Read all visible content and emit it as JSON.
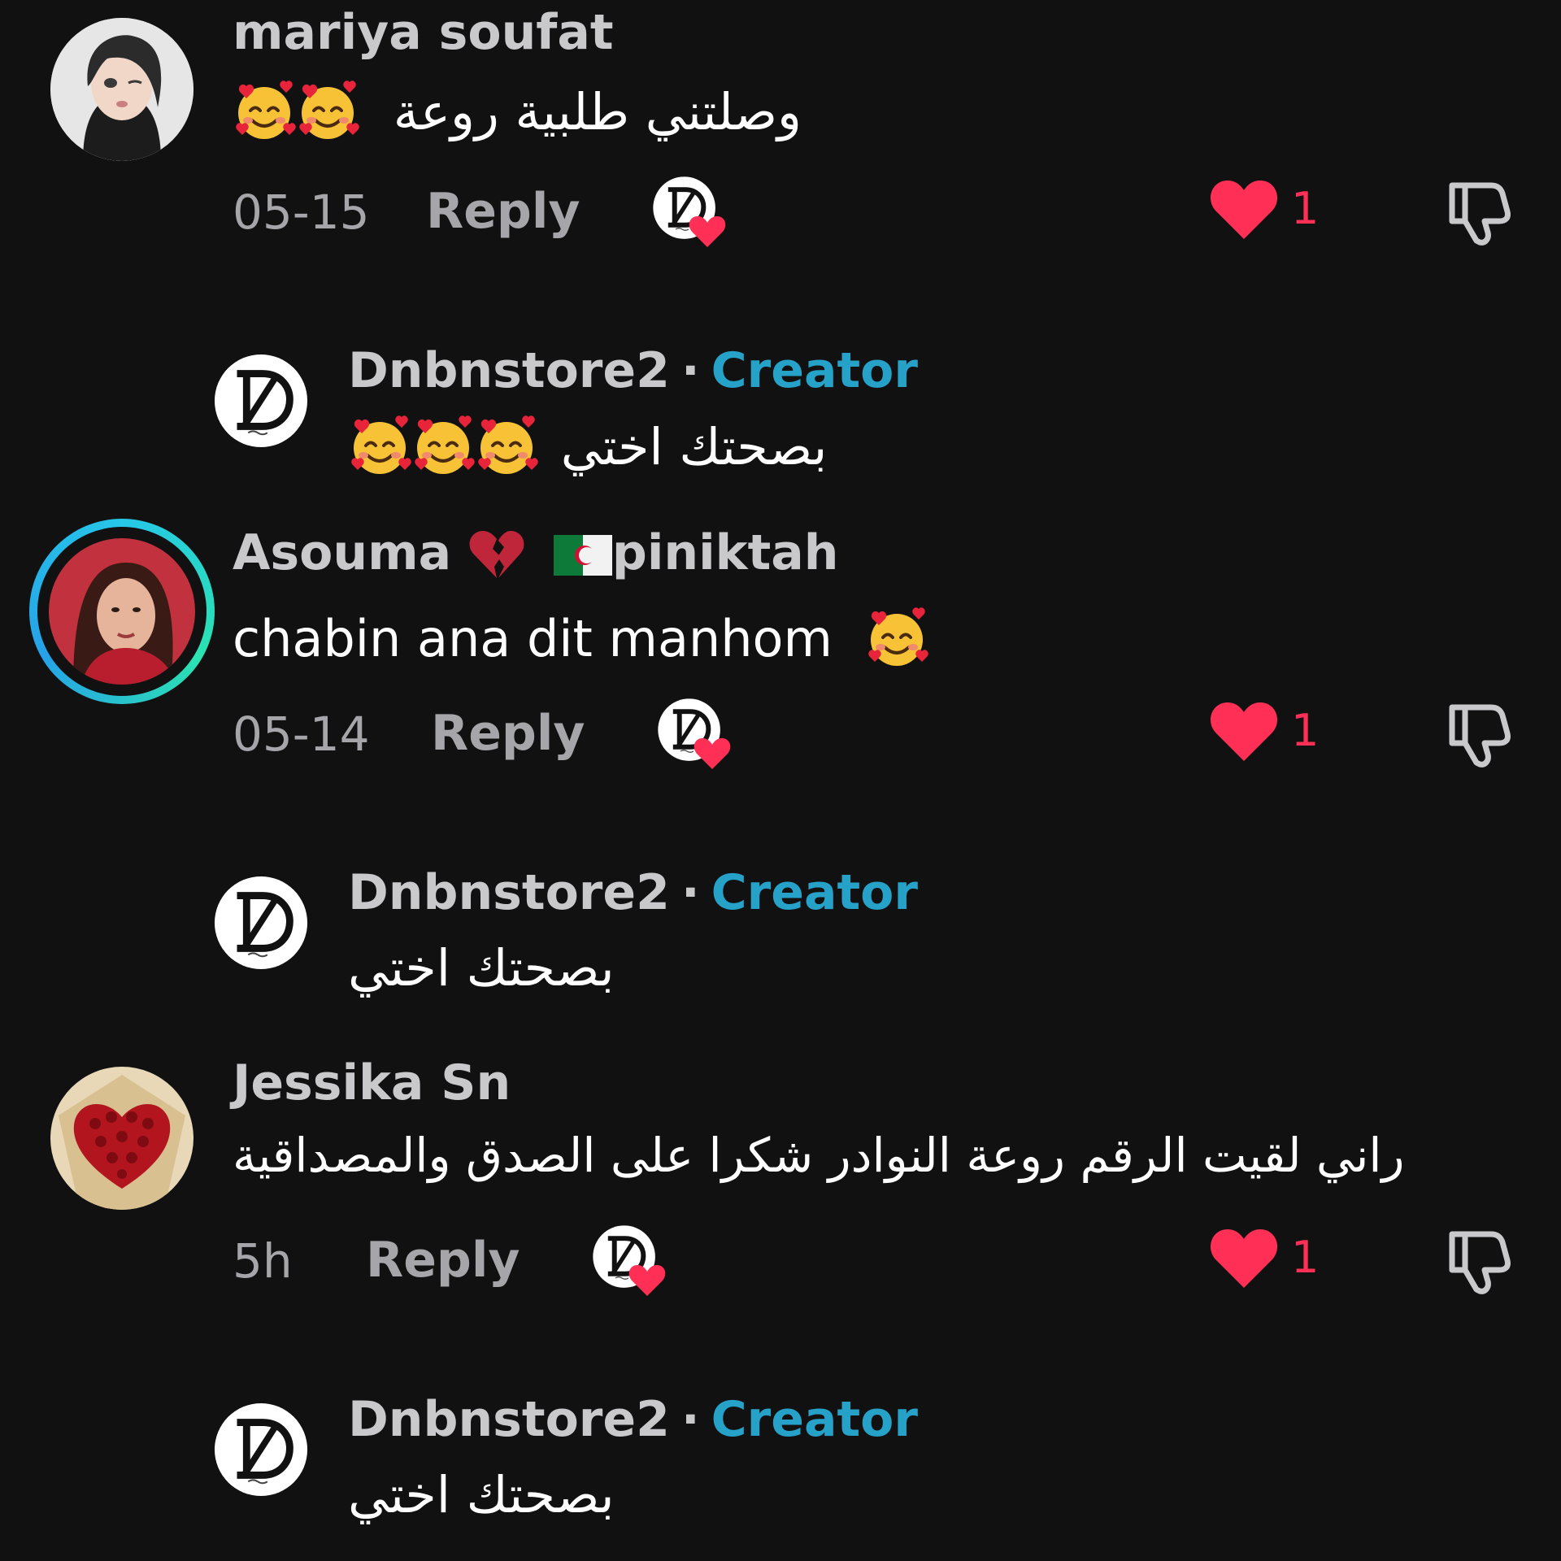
{
  "colors": {
    "background": "#111112",
    "username": "#c9c9cc",
    "creator_badge": "#26a2c9",
    "like_heart": "#ff2f56",
    "meta_text": "#a6a6aa"
  },
  "icons": {
    "emoji": "smiling-face-with-hearts",
    "like": "heart-icon",
    "dislike": "thumbs-down-icon",
    "creator_liked": "creator-avatar-with-heart"
  },
  "comments": [
    {
      "username": "mariya soufat",
      "text": "وصلتني طلبية روعة",
      "date": "05-15",
      "reply_label": "Reply",
      "like_count": "1"
    },
    {
      "username": "Dnbnstore2",
      "creator_label": "Creator",
      "text": "بصحتك اختي",
      "is_reply": true
    },
    {
      "username": "Asouma",
      "username_suffix": "piniktah",
      "text": "chabin ana dit manhom",
      "date": "05-14",
      "reply_label": "Reply",
      "like_count": "1"
    },
    {
      "username": "Dnbnstore2",
      "creator_label": "Creator",
      "text": "بصحتك اختي",
      "is_reply": true
    },
    {
      "username": "Jessika Sn",
      "text": "راني لقيت الرقم روعة النوادر شكرا على الصدق والمصداقية",
      "date": "5h",
      "reply_label": "Reply",
      "like_count": "1"
    },
    {
      "username": "Dnbnstore2",
      "creator_label": "Creator",
      "text": "بصحتك اختي",
      "is_reply": true
    }
  ]
}
